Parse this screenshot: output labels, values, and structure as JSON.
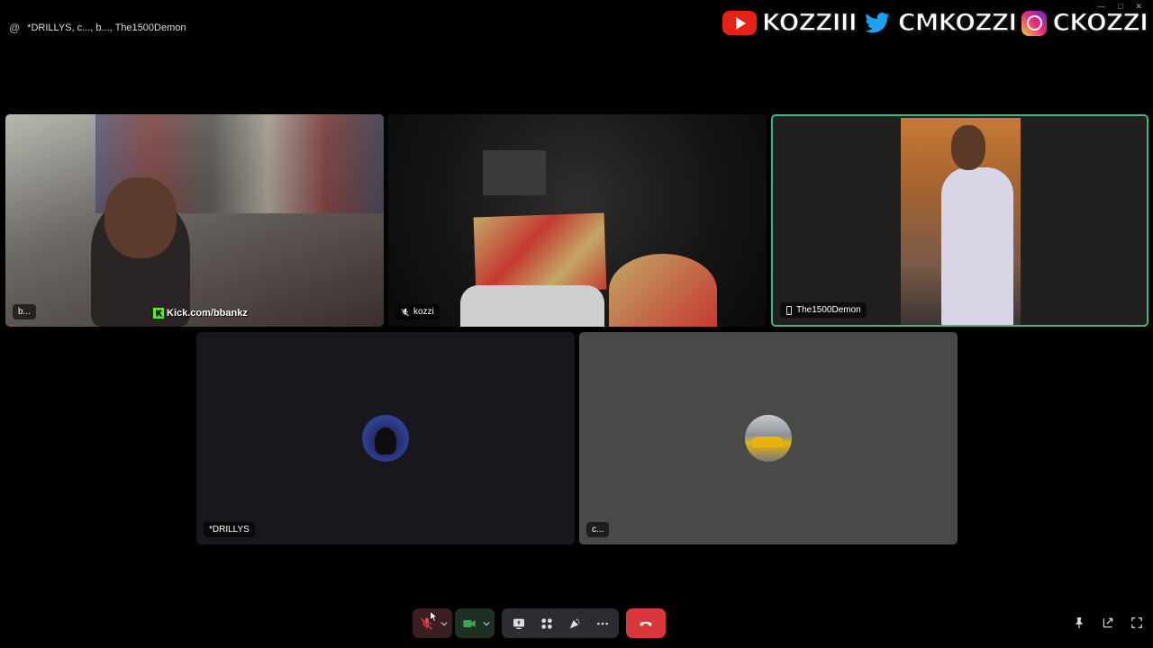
{
  "header": {
    "at_symbol": "@",
    "call_title": "*DRILLYS, c..., b..., The1500Demon"
  },
  "socials": {
    "youtube_handle": "KOZZIII",
    "twitter_handle": "CMKOZZI",
    "instagram_handle": "CKOZZI"
  },
  "tiles": [
    {
      "name": "b...",
      "overlay_text": "Kick.com/bbankz",
      "kick_logo": "K"
    },
    {
      "name": "kozzi",
      "muted": true
    },
    {
      "name": "The1500Demon",
      "on_mobile": true,
      "speaking": true
    },
    {
      "name": "*DRILLYS"
    },
    {
      "name": "c..."
    }
  ],
  "colors": {
    "speaking_border": "#43b581",
    "leave_button": "#da373c",
    "mute_active": "#ed4245",
    "camera_on": "#3ba55c",
    "kick_green": "#53fc18"
  },
  "controls": {
    "mute_icon": "mic-off-icon",
    "camera_icon": "video-camera-icon",
    "share_icon": "screen-share-icon",
    "activity_icon": "activities-icon",
    "soundboard_icon": "soundboard-icon",
    "more_icon": "more-icon",
    "leave_icon": "hang-up-icon",
    "pin_icon": "pin-icon",
    "popout_icon": "popout-icon",
    "fullscreen_icon": "fullscreen-icon"
  }
}
